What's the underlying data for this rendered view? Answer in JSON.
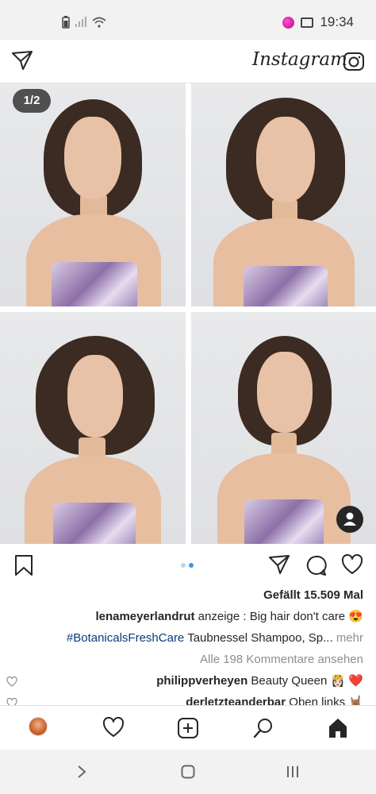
{
  "status_bar": {
    "time": "19:34",
    "icons": [
      "app-notification-icon",
      "image-icon",
      "wifi-icon",
      "signal-icon",
      "battery-icon"
    ]
  },
  "header": {
    "logo": "Instagram",
    "icons": [
      "camera-icon",
      "direct-message-icon"
    ]
  },
  "post": {
    "counter": "1/2",
    "carousel": {
      "current": 2,
      "total": 2
    },
    "photos": 4,
    "likes": "Gefällt 15.509 Mal",
    "caption": {
      "username": "lenameyerlandrut",
      "text": "anzeige : Big hair don't care 😍",
      "hashtag": "#BotanicalsFreshCare",
      "rest": "Taubnessel Shampoo, Sp...",
      "more": "mehr"
    },
    "view_comments": "Alle 198 Kommentare ansehen",
    "comments": [
      {
        "username": "philippverheyen",
        "text": "Beauty Queen 👸🏻 ❤️"
      },
      {
        "username": "derletzteanderbar",
        "text": "Oben links 🤘🏽"
      }
    ]
  },
  "bottom_nav": {
    "items": [
      "home-icon",
      "search-icon",
      "new-post-icon",
      "activity-icon",
      "profile-avatar"
    ]
  },
  "colors": {
    "accent": "#3897f0",
    "hashtag": "#0b3a7d",
    "heart_red": "#ed4956"
  }
}
